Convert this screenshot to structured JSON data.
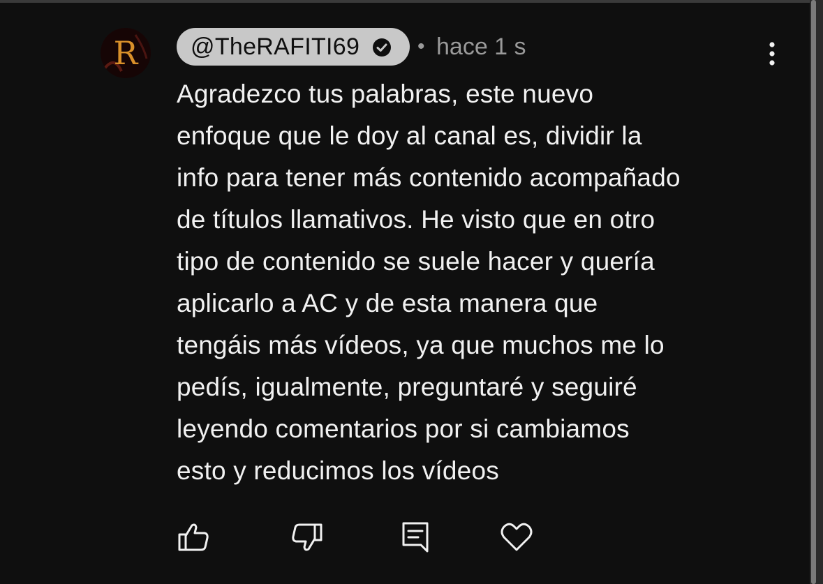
{
  "comment": {
    "author": "@TheRAFITI69",
    "separator": "•",
    "time": "hace 1 s",
    "lines": [
      "Agradezco tus palabras, este nuevo",
      "enfoque que le doy al canal es, dividir la",
      "info para tener más contenido acompañado",
      "de títulos llamativos. He visto que en otro",
      "tipo de contenido se suele hacer y quería",
      "aplicarlo a AC y de esta manera que",
      "tengáis más vídeos, ya que muchos me lo",
      "pedís, igualmente, preguntaré y seguiré",
      "leyendo comentarios por si cambiamos",
      "esto y reducimos los vídeos"
    ],
    "avatar_letter": "R"
  },
  "icons": {
    "verified": "verified-check-icon",
    "more": "more-vertical-icon",
    "like": "thumbs-up-icon",
    "dislike": "thumbs-down-icon",
    "reply": "reply-comment-icon",
    "heart": "heart-icon"
  },
  "colors": {
    "background": "#0f0f0f",
    "text": "#f1f1f1",
    "muted": "#9a9a9a",
    "author_pill": "#c8c8c8",
    "avatar_letter": "#d9902a"
  }
}
